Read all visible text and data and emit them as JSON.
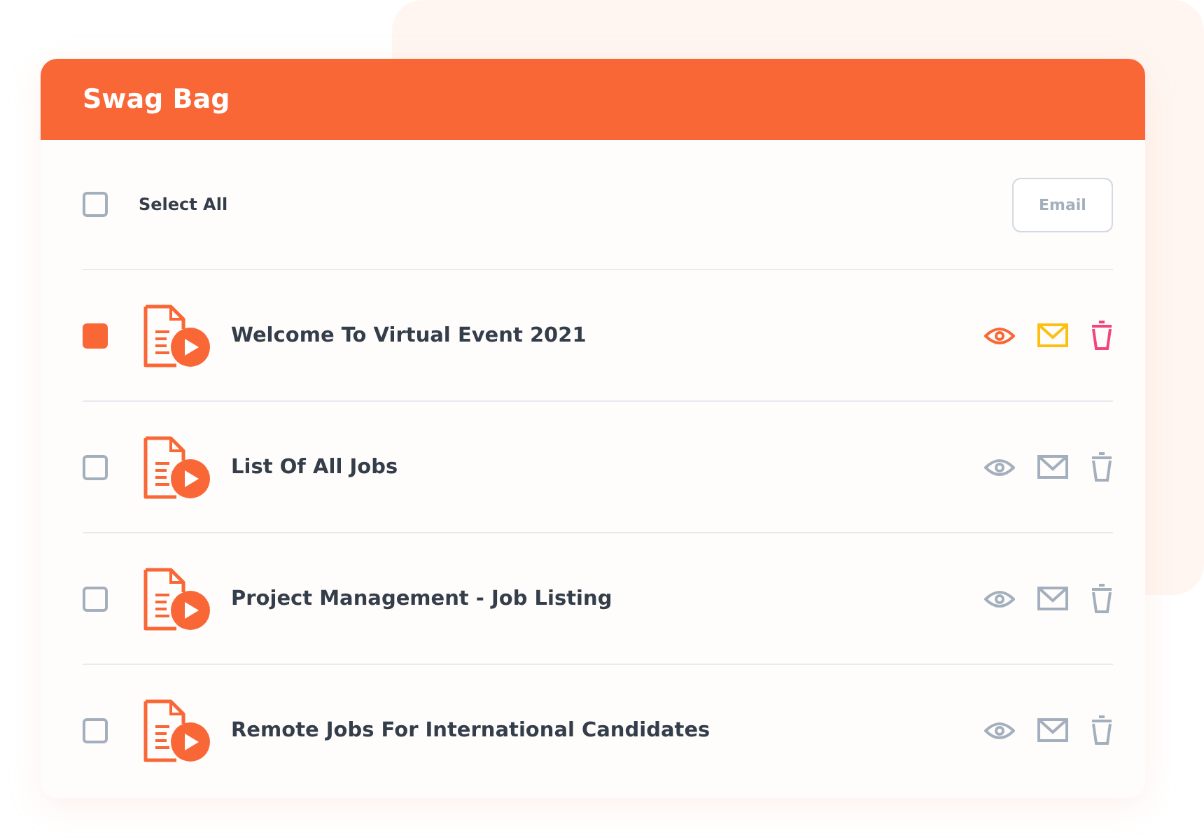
{
  "card": {
    "title": "Swag Bag"
  },
  "select_all": {
    "label": "Select All",
    "checked": false
  },
  "email_button": {
    "label": "Email",
    "disabled": true
  },
  "items": [
    {
      "title": "Welcome To Virtual Event 2021",
      "checked": true
    },
    {
      "title": "List Of All Jobs",
      "checked": false
    },
    {
      "title": "Project Management - Job Listing",
      "checked": false
    },
    {
      "title": "Remote Jobs For International Candidates",
      "checked": false
    }
  ]
}
